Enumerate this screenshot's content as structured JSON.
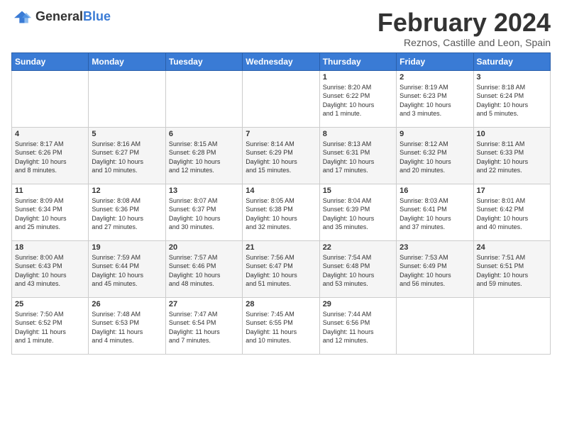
{
  "header": {
    "logo_general": "General",
    "logo_blue": "Blue",
    "month_title": "February 2024",
    "location": "Reznos, Castille and Leon, Spain"
  },
  "days_of_week": [
    "Sunday",
    "Monday",
    "Tuesday",
    "Wednesday",
    "Thursday",
    "Friday",
    "Saturday"
  ],
  "weeks": [
    [
      {
        "day": "",
        "info": ""
      },
      {
        "day": "",
        "info": ""
      },
      {
        "day": "",
        "info": ""
      },
      {
        "day": "",
        "info": ""
      },
      {
        "day": "1",
        "info": "Sunrise: 8:20 AM\nSunset: 6:22 PM\nDaylight: 10 hours\nand 1 minute."
      },
      {
        "day": "2",
        "info": "Sunrise: 8:19 AM\nSunset: 6:23 PM\nDaylight: 10 hours\nand 3 minutes."
      },
      {
        "day": "3",
        "info": "Sunrise: 8:18 AM\nSunset: 6:24 PM\nDaylight: 10 hours\nand 5 minutes."
      }
    ],
    [
      {
        "day": "4",
        "info": "Sunrise: 8:17 AM\nSunset: 6:26 PM\nDaylight: 10 hours\nand 8 minutes."
      },
      {
        "day": "5",
        "info": "Sunrise: 8:16 AM\nSunset: 6:27 PM\nDaylight: 10 hours\nand 10 minutes."
      },
      {
        "day": "6",
        "info": "Sunrise: 8:15 AM\nSunset: 6:28 PM\nDaylight: 10 hours\nand 12 minutes."
      },
      {
        "day": "7",
        "info": "Sunrise: 8:14 AM\nSunset: 6:29 PM\nDaylight: 10 hours\nand 15 minutes."
      },
      {
        "day": "8",
        "info": "Sunrise: 8:13 AM\nSunset: 6:31 PM\nDaylight: 10 hours\nand 17 minutes."
      },
      {
        "day": "9",
        "info": "Sunrise: 8:12 AM\nSunset: 6:32 PM\nDaylight: 10 hours\nand 20 minutes."
      },
      {
        "day": "10",
        "info": "Sunrise: 8:11 AM\nSunset: 6:33 PM\nDaylight: 10 hours\nand 22 minutes."
      }
    ],
    [
      {
        "day": "11",
        "info": "Sunrise: 8:09 AM\nSunset: 6:34 PM\nDaylight: 10 hours\nand 25 minutes."
      },
      {
        "day": "12",
        "info": "Sunrise: 8:08 AM\nSunset: 6:36 PM\nDaylight: 10 hours\nand 27 minutes."
      },
      {
        "day": "13",
        "info": "Sunrise: 8:07 AM\nSunset: 6:37 PM\nDaylight: 10 hours\nand 30 minutes."
      },
      {
        "day": "14",
        "info": "Sunrise: 8:05 AM\nSunset: 6:38 PM\nDaylight: 10 hours\nand 32 minutes."
      },
      {
        "day": "15",
        "info": "Sunrise: 8:04 AM\nSunset: 6:39 PM\nDaylight: 10 hours\nand 35 minutes."
      },
      {
        "day": "16",
        "info": "Sunrise: 8:03 AM\nSunset: 6:41 PM\nDaylight: 10 hours\nand 37 minutes."
      },
      {
        "day": "17",
        "info": "Sunrise: 8:01 AM\nSunset: 6:42 PM\nDaylight: 10 hours\nand 40 minutes."
      }
    ],
    [
      {
        "day": "18",
        "info": "Sunrise: 8:00 AM\nSunset: 6:43 PM\nDaylight: 10 hours\nand 43 minutes."
      },
      {
        "day": "19",
        "info": "Sunrise: 7:59 AM\nSunset: 6:44 PM\nDaylight: 10 hours\nand 45 minutes."
      },
      {
        "day": "20",
        "info": "Sunrise: 7:57 AM\nSunset: 6:46 PM\nDaylight: 10 hours\nand 48 minutes."
      },
      {
        "day": "21",
        "info": "Sunrise: 7:56 AM\nSunset: 6:47 PM\nDaylight: 10 hours\nand 51 minutes."
      },
      {
        "day": "22",
        "info": "Sunrise: 7:54 AM\nSunset: 6:48 PM\nDaylight: 10 hours\nand 53 minutes."
      },
      {
        "day": "23",
        "info": "Sunrise: 7:53 AM\nSunset: 6:49 PM\nDaylight: 10 hours\nand 56 minutes."
      },
      {
        "day": "24",
        "info": "Sunrise: 7:51 AM\nSunset: 6:51 PM\nDaylight: 10 hours\nand 59 minutes."
      }
    ],
    [
      {
        "day": "25",
        "info": "Sunrise: 7:50 AM\nSunset: 6:52 PM\nDaylight: 11 hours\nand 1 minute."
      },
      {
        "day": "26",
        "info": "Sunrise: 7:48 AM\nSunset: 6:53 PM\nDaylight: 11 hours\nand 4 minutes."
      },
      {
        "day": "27",
        "info": "Sunrise: 7:47 AM\nSunset: 6:54 PM\nDaylight: 11 hours\nand 7 minutes."
      },
      {
        "day": "28",
        "info": "Sunrise: 7:45 AM\nSunset: 6:55 PM\nDaylight: 11 hours\nand 10 minutes."
      },
      {
        "day": "29",
        "info": "Sunrise: 7:44 AM\nSunset: 6:56 PM\nDaylight: 11 hours\nand 12 minutes."
      },
      {
        "day": "",
        "info": ""
      },
      {
        "day": "",
        "info": ""
      }
    ]
  ]
}
